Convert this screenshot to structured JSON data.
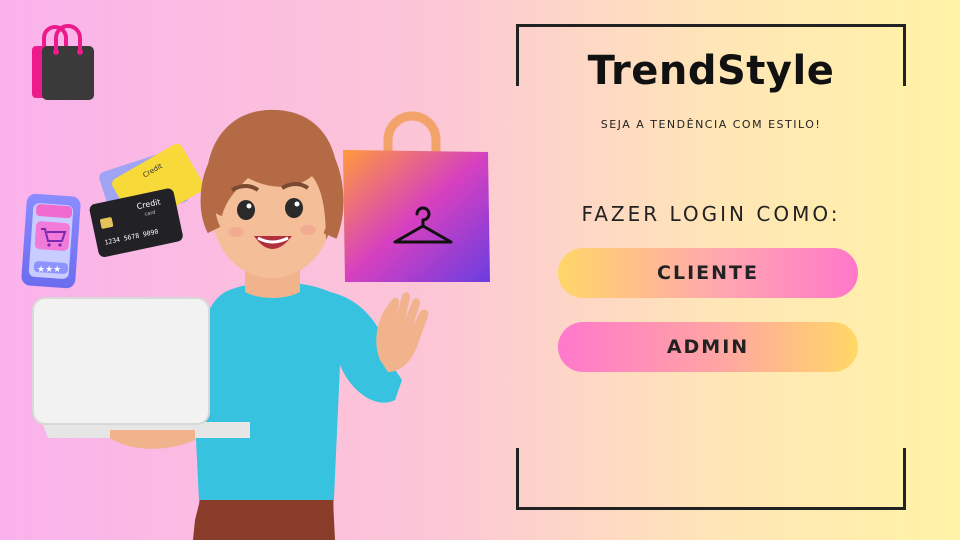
{
  "brand": {
    "title": "TrendStyle",
    "tagline": "SEJA A TENDÊNCIA COM ESTILO!"
  },
  "login": {
    "prompt": "FAZER LOGIN COMO:",
    "cliente_label": "CLIENTE",
    "admin_label": "ADMIN"
  },
  "icons": {
    "logo": "shopping-bag-icon",
    "bag": "hanger-icon",
    "phone": "shopping-cart-icon"
  },
  "card_text": {
    "front_label": "Credit",
    "front_sub": "card",
    "front_number": "1234 5678 9090",
    "back_label": "Credit"
  },
  "colors": {
    "text": "#222222",
    "accent_pink": "#ff77c9",
    "accent_yellow": "#ffd668",
    "shirt": "#37c3e0"
  }
}
